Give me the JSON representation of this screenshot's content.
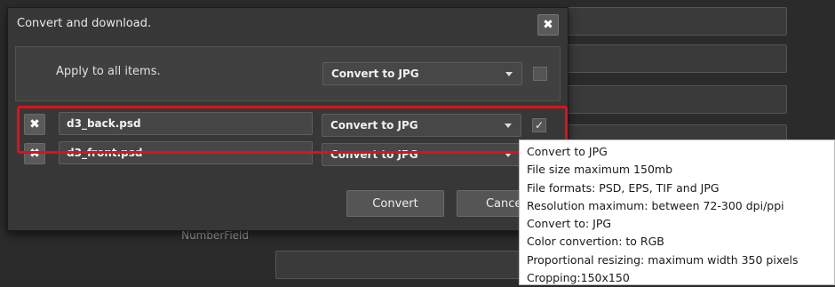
{
  "background": {
    "number_field_label": "NumberField"
  },
  "dialog": {
    "title": "Convert and download.",
    "apply_all": {
      "label": "Apply to all  items.",
      "select_value": "Convert to JPG",
      "checked": false
    },
    "items": [
      {
        "filename": "d3_back.psd",
        "select_value": "Convert to JPG",
        "checked": true,
        "checkmark": "✓"
      },
      {
        "filename": "d3_front.psd",
        "select_value": "Convert to JPG",
        "checked": false,
        "checkmark": ""
      }
    ],
    "buttons": {
      "convert": "Convert",
      "cancel": "Cancel"
    }
  },
  "tooltip": {
    "lines": [
      "Convert to JPG",
      "File size maximum 150mb",
      "File formats: PSD, EPS, TIF and JPG",
      "Resolution maximum: between 72-300 dpi/ppi",
      "Convert to: JPG",
      "Color convertion: to RGB",
      "Proportional resizing: maximum width 350 pixels",
      "Cropping:150x150"
    ]
  },
  "colors": {
    "highlight": "#e0101a",
    "dialog_bg": "#373737",
    "page_bg": "#2b2b2b"
  }
}
